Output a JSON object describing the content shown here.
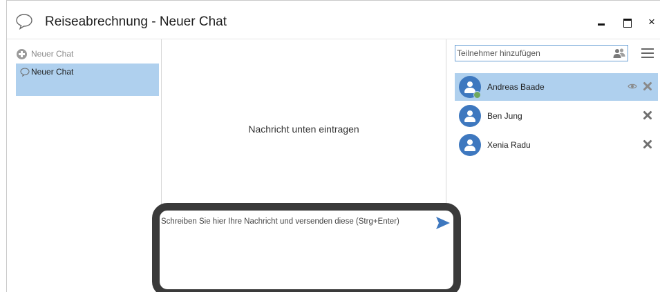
{
  "window": {
    "title": "Reiseabrechnung - Neuer Chat",
    "icons": {
      "title": "speech-bubble-icon",
      "minimize": "minimize-icon",
      "maximize": "maximize-icon",
      "close": "close-icon"
    },
    "close_glyph": "×"
  },
  "sidebar": {
    "new_chat_label": "Neuer Chat",
    "chats": [
      {
        "label": "Neuer Chat",
        "selected": true
      }
    ]
  },
  "main": {
    "empty_message": "Nachricht unten eintragen",
    "compose": {
      "placeholder": "Schreiben Sie hier Ihre Nachricht und versenden diese (Strg+Enter)",
      "value": ""
    }
  },
  "participants": {
    "search_placeholder": "Teilnehmer hinzufügen",
    "list": [
      {
        "name": "Andreas Baade",
        "selected": true,
        "online": true,
        "watching": true
      },
      {
        "name": "Ben Jung",
        "selected": false,
        "online": false,
        "watching": false
      },
      {
        "name": "Xenia Radu",
        "selected": false,
        "online": false,
        "watching": false
      }
    ]
  },
  "colors": {
    "selection": "#afd0ee",
    "avatar": "#3e78bf",
    "presence_online": "#6fa85d",
    "send_arrow": "#3e78bf",
    "focus_frame": "#3a3a3a"
  }
}
